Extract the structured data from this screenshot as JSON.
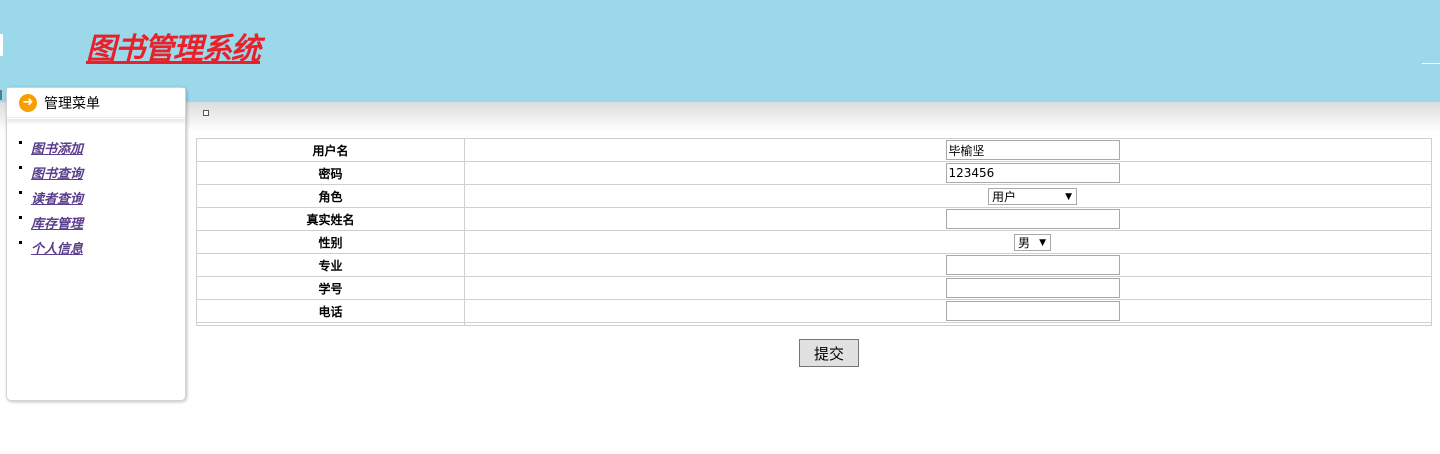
{
  "header": {
    "app_title": "图书管理系统",
    "background_color": "#9bd9ea",
    "title_color": "#e8202a"
  },
  "sidebar": {
    "menu_title": "管理菜单",
    "menu_icon": "arrow-right-icon",
    "items": [
      {
        "label": "图书添加"
      },
      {
        "label": "图书查询"
      },
      {
        "label": "读者查询"
      },
      {
        "label": "库存管理"
      },
      {
        "label": "个人信息"
      }
    ]
  },
  "form": {
    "fields": [
      {
        "label": "用户名",
        "value": "毕榆坚"
      },
      {
        "label": "密码",
        "value": "123456"
      },
      {
        "label": "角色",
        "value": "用户"
      },
      {
        "label": "真实姓名",
        "value": ""
      },
      {
        "label": "性别",
        "value": "男"
      },
      {
        "label": "专业",
        "value": ""
      },
      {
        "label": "学号",
        "value": ""
      },
      {
        "label": "电话",
        "value": ""
      }
    ],
    "submit_label": "提交"
  }
}
